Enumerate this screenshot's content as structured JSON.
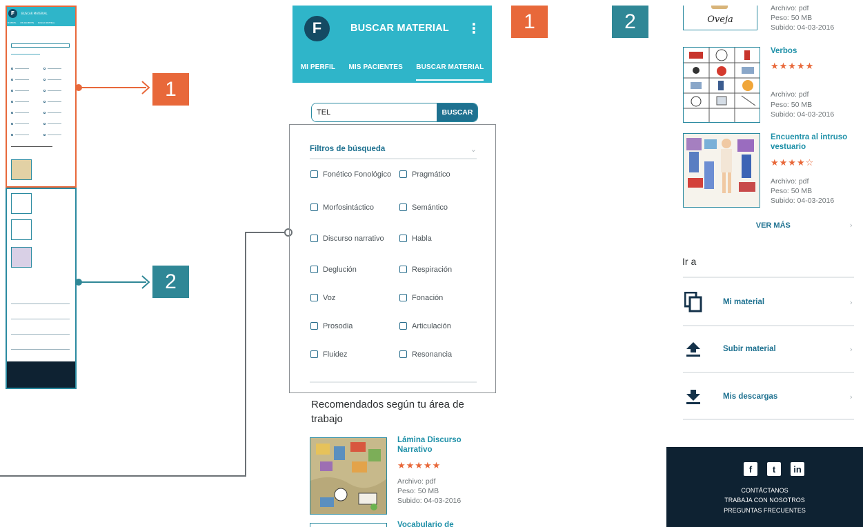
{
  "badges": {
    "one": "1",
    "two": "2"
  },
  "colors": {
    "primary": "#2fb5c9",
    "dark": "#144a63",
    "accent_orange": "#e8683a",
    "accent_teal": "#2f8796",
    "footer": "#0e2232"
  },
  "app": {
    "title": "BUSCAR MATERIAL",
    "menu_icon": "kebab-menu-icon",
    "tabs": [
      "MI PERFIL",
      "MIS PACIENTES",
      "BUSCAR MATERIAL"
    ]
  },
  "search": {
    "value": "TEL",
    "button": "BUSCAR"
  },
  "filters": {
    "title": "Filtros de búsqueda",
    "left": [
      "Fonético Fonológico",
      "Morfosintáctico",
      "Discurso narrativo",
      "Deglución",
      "Voz",
      "Prosodia",
      "Fluidez"
    ],
    "right": [
      "Pragmático",
      "Semántico",
      "Habla",
      "Respiración",
      "Fonación",
      "Articulación",
      "Resonancia"
    ]
  },
  "recommended": {
    "title": "Recomendados según tu área de trabajo",
    "items": [
      {
        "title": "Lámina Discurso Narrativo",
        "rating": 4.5,
        "stars": "★★★★★",
        "file": "Archivo: pdf",
        "size": "Peso: 50 MB",
        "date": "Subido: 04-03-2016"
      },
      {
        "title": "Vocabulario de"
      }
    ]
  },
  "results": {
    "items": [
      {
        "caption": "Oveja",
        "file": "Archivo: pdf",
        "size": "Peso: 50 MB",
        "date": "Subido: 04-03-2016"
      },
      {
        "title": "Verbos",
        "rating": 4.5,
        "stars": "★★★★★",
        "file": "Archivo: pdf",
        "size": "Peso: 50 MB",
        "date": "Subido: 04-03-2016"
      },
      {
        "title": "Encuentra al intruso vestuario",
        "rating": 4,
        "stars": "★★★★☆",
        "file": "Archivo: pdf",
        "size": "Peso: 50 MB",
        "date": "Subido: 04-03-2016"
      }
    ],
    "more": "VER MÁS"
  },
  "goto": {
    "title": "Ir a",
    "links": [
      {
        "label": "Mi material",
        "icon": "copy-icon"
      },
      {
        "label": "Subir material",
        "icon": "upload-icon"
      },
      {
        "label": "Mis descargas",
        "icon": "download-icon"
      }
    ]
  },
  "footer": {
    "social": [
      "facebook-icon",
      "twitter-icon",
      "linkedin-icon"
    ],
    "links": [
      "CONTÁCTANOS",
      "TRABAJA CON NOSOTROS",
      "PREGUNTAS FRECUENTES"
    ]
  }
}
